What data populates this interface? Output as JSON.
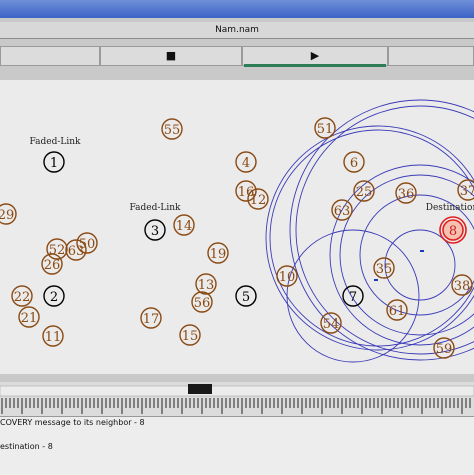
{
  "window": {
    "title": "Nam.nam"
  },
  "controls": [
    {
      "name": "rewind-button",
      "label": "",
      "interact": true
    },
    {
      "name": "stop-button",
      "label": "■",
      "interact": true
    },
    {
      "name": "play-button",
      "label": "▶",
      "interact": true
    },
    {
      "name": "fast-forward-button",
      "label": "",
      "interact": true
    }
  ],
  "canvas": {
    "labels": [
      {
        "text": "Faded-Link"
      },
      {
        "text": "Faded-Link"
      },
      {
        "text": "Destination"
      }
    ],
    "nodes": [
      {
        "id": "1",
        "kind": "black"
      },
      {
        "id": "2",
        "kind": "black"
      },
      {
        "id": "3",
        "kind": "black"
      },
      {
        "id": "5",
        "kind": "black"
      },
      {
        "id": "7",
        "kind": "black"
      },
      {
        "id": "8",
        "kind": "destination"
      },
      {
        "id": "55",
        "kind": "brown"
      },
      {
        "id": "51",
        "kind": "brown"
      },
      {
        "id": "4",
        "kind": "brown"
      },
      {
        "id": "6",
        "kind": "brown"
      },
      {
        "id": "16",
        "kind": "brown"
      },
      {
        "id": "12",
        "kind": "brown"
      },
      {
        "id": "25",
        "kind": "brown"
      },
      {
        "id": "36",
        "kind": "brown"
      },
      {
        "id": "37",
        "kind": "brown"
      },
      {
        "id": "63",
        "kind": "brown"
      },
      {
        "id": "14",
        "kind": "brown"
      },
      {
        "id": "29",
        "kind": "brown"
      },
      {
        "id": "52",
        "kind": "brown"
      },
      {
        "id": "63",
        "kind": "brown"
      },
      {
        "id": "50",
        "kind": "brown"
      },
      {
        "id": "26",
        "kind": "brown"
      },
      {
        "id": "19",
        "kind": "brown"
      },
      {
        "id": "10",
        "kind": "brown"
      },
      {
        "id": "35",
        "kind": "brown"
      },
      {
        "id": "38",
        "kind": "brown"
      },
      {
        "id": "22",
        "kind": "brown"
      },
      {
        "id": "13",
        "kind": "brown"
      },
      {
        "id": "56",
        "kind": "brown"
      },
      {
        "id": "21",
        "kind": "brown"
      },
      {
        "id": "17",
        "kind": "brown"
      },
      {
        "id": "61",
        "kind": "brown"
      },
      {
        "id": "54",
        "kind": "brown"
      },
      {
        "id": "11",
        "kind": "brown"
      },
      {
        "id": "15",
        "kind": "brown"
      },
      {
        "id": "59",
        "kind": "brown"
      }
    ]
  },
  "messages": [
    "COVERY message to its neighbor - 8",
    "estination - 8"
  ],
  "colors": {
    "brown": "#8a4a14",
    "black": "#000000",
    "destination": "#e02020",
    "ring": "#3a3ab8"
  }
}
